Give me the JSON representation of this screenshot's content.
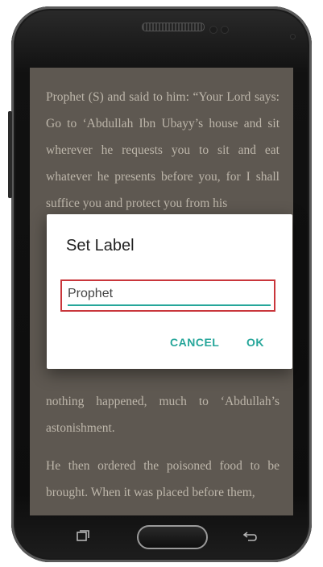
{
  "reader": {
    "top_text": "Prophet (S) and said to him: “Your Lord says: Go to ‘Abdullah Ibn Ubayy’s house and sit wherever he requests you to sit and eat whatever he presents before you, for I shall suffice you and protect you from his",
    "bottom_text_1": "nothing happened, much to ‘Abdullah’s astonishment.",
    "bottom_text_2": "He then ordered the poisoned food to be brought. When it was placed before them,"
  },
  "dialog": {
    "title": "Set Label",
    "input_value": "Prophet",
    "cancel_label": "CANCEL",
    "ok_label": "OK"
  },
  "nav": {
    "recents_icon": "recents-icon",
    "home_icon": "home-button",
    "back_icon": "back-icon"
  },
  "colors": {
    "accent": "#26a69a",
    "highlight": "#c9363b",
    "screen_bg": "#5e5851"
  }
}
